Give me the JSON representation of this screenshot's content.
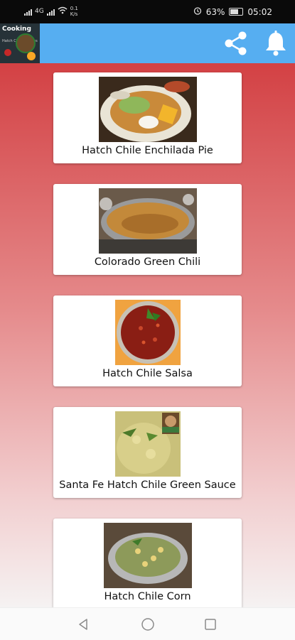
{
  "status_bar": {
    "network": "4G",
    "speed_value": "0.1",
    "speed_unit": "K/s",
    "battery": "63%",
    "time": "05:02"
  },
  "app_bar": {
    "logo_text": "Cooking",
    "logo_sub": "Hatch Chile Recipes",
    "share_icon": "share-icon",
    "bell_icon": "bell-icon"
  },
  "colors": {
    "app_bar": "#56aef1",
    "gradient_top": "#d34144",
    "gradient_bottom": "#f5f2f2"
  },
  "recipes": [
    {
      "title": "Hatch Chile Enchilada Pie"
    },
    {
      "title": "Colorado Green Chili"
    },
    {
      "title": "Hatch Chile Salsa"
    },
    {
      "title": "Santa Fe Hatch Chile Green Sauce"
    },
    {
      "title": "Hatch Chile Corn"
    }
  ],
  "nav": {
    "back": "back-icon",
    "home": "home-icon",
    "recents": "recents-icon"
  }
}
